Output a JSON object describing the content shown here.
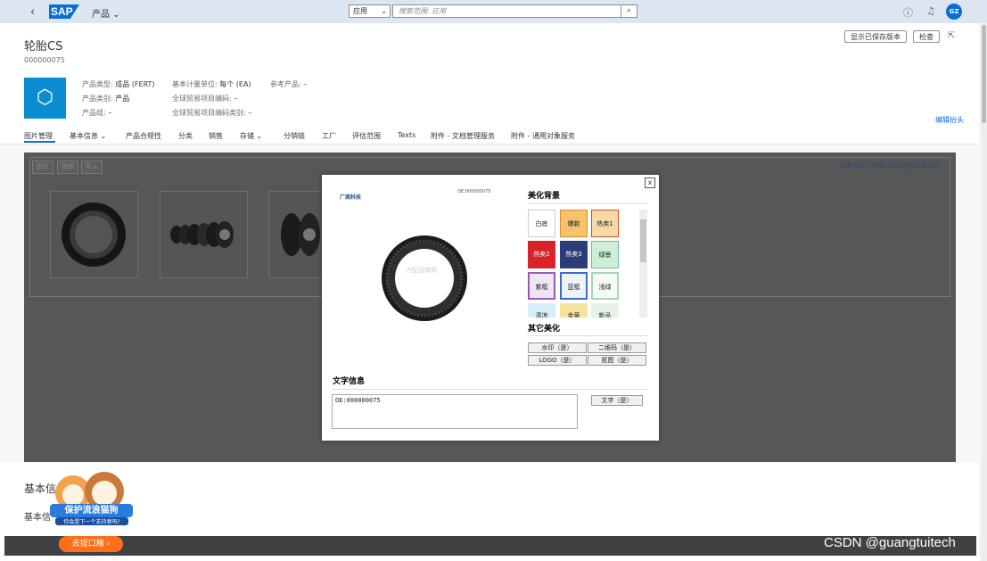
{
  "shell": {
    "app_name": "产品",
    "scope": "应用",
    "search_placeholder": "搜索范围: 应用",
    "avatar": "GZ"
  },
  "header": {
    "title": "轮胎CS",
    "number": "000000075",
    "buttons": {
      "saved_version": "显示已保存版本",
      "check": "检查"
    },
    "edit_header": "编辑抬头",
    "attrs": {
      "type_k": "产品类型:",
      "type_v": "成品 (FERT)",
      "category_k": "产品类别:",
      "category_v": "产品",
      "group_k": "产品组:",
      "group_v": "–",
      "unit_k": "基本计量单位:",
      "unit_v": "每个 (EA)",
      "gtin_k": "全球贸易项目编码:",
      "gtin_v": "–",
      "gtin_cat_k": "全球贸易项目编码类别:",
      "gtin_cat_v": "–",
      "ref_k": "参考产品:",
      "ref_v": "–"
    }
  },
  "tabs": [
    "图片管理",
    "基本信息",
    "产品合规性",
    "分类",
    "销售",
    "存储",
    "分销链",
    "工厂",
    "评估范围",
    "Texts",
    "附件 - 文档管理服务",
    "附件 - 通用对象服务"
  ],
  "content": {
    "subtabs": [
      "图片",
      "视频",
      "导入"
    ],
    "right_link": "本服务为广州商汇科技提供技术支持"
  },
  "modal": {
    "close": "x",
    "logo_text": "广商科技",
    "oe_small": "OE:000000075",
    "watermark": "汽配油商网",
    "beautify_title": "美化背景",
    "swatches": [
      "白底",
      "爆款",
      "热卖1",
      "热卖2",
      "热卖3",
      "绿景",
      "紫框",
      "蓝框",
      "浅绿",
      "清凉",
      "金黄",
      "新品"
    ],
    "other_title": "其它美化",
    "other_buttons": [
      "水印（是）",
      "二维码（是）",
      "LOGO（是）",
      "抠图（是）"
    ],
    "text_title": "文字信息",
    "text_value": "OE:000000075",
    "text_button": "文字（是）"
  },
  "lower": {
    "section1": "基本信",
    "section2": "基本信"
  },
  "overlay": {
    "mascot_title": "保护流浪猫狗",
    "mascot_sub": "你会是下一个支持者吗?",
    "promo_button": "去提口粮 ›",
    "watermark": "CSDN @guangtuitech"
  },
  "colors": {
    "accent": "#0a6ed1",
    "shell": "#dce6f0",
    "promo": "#ff6f1a"
  }
}
